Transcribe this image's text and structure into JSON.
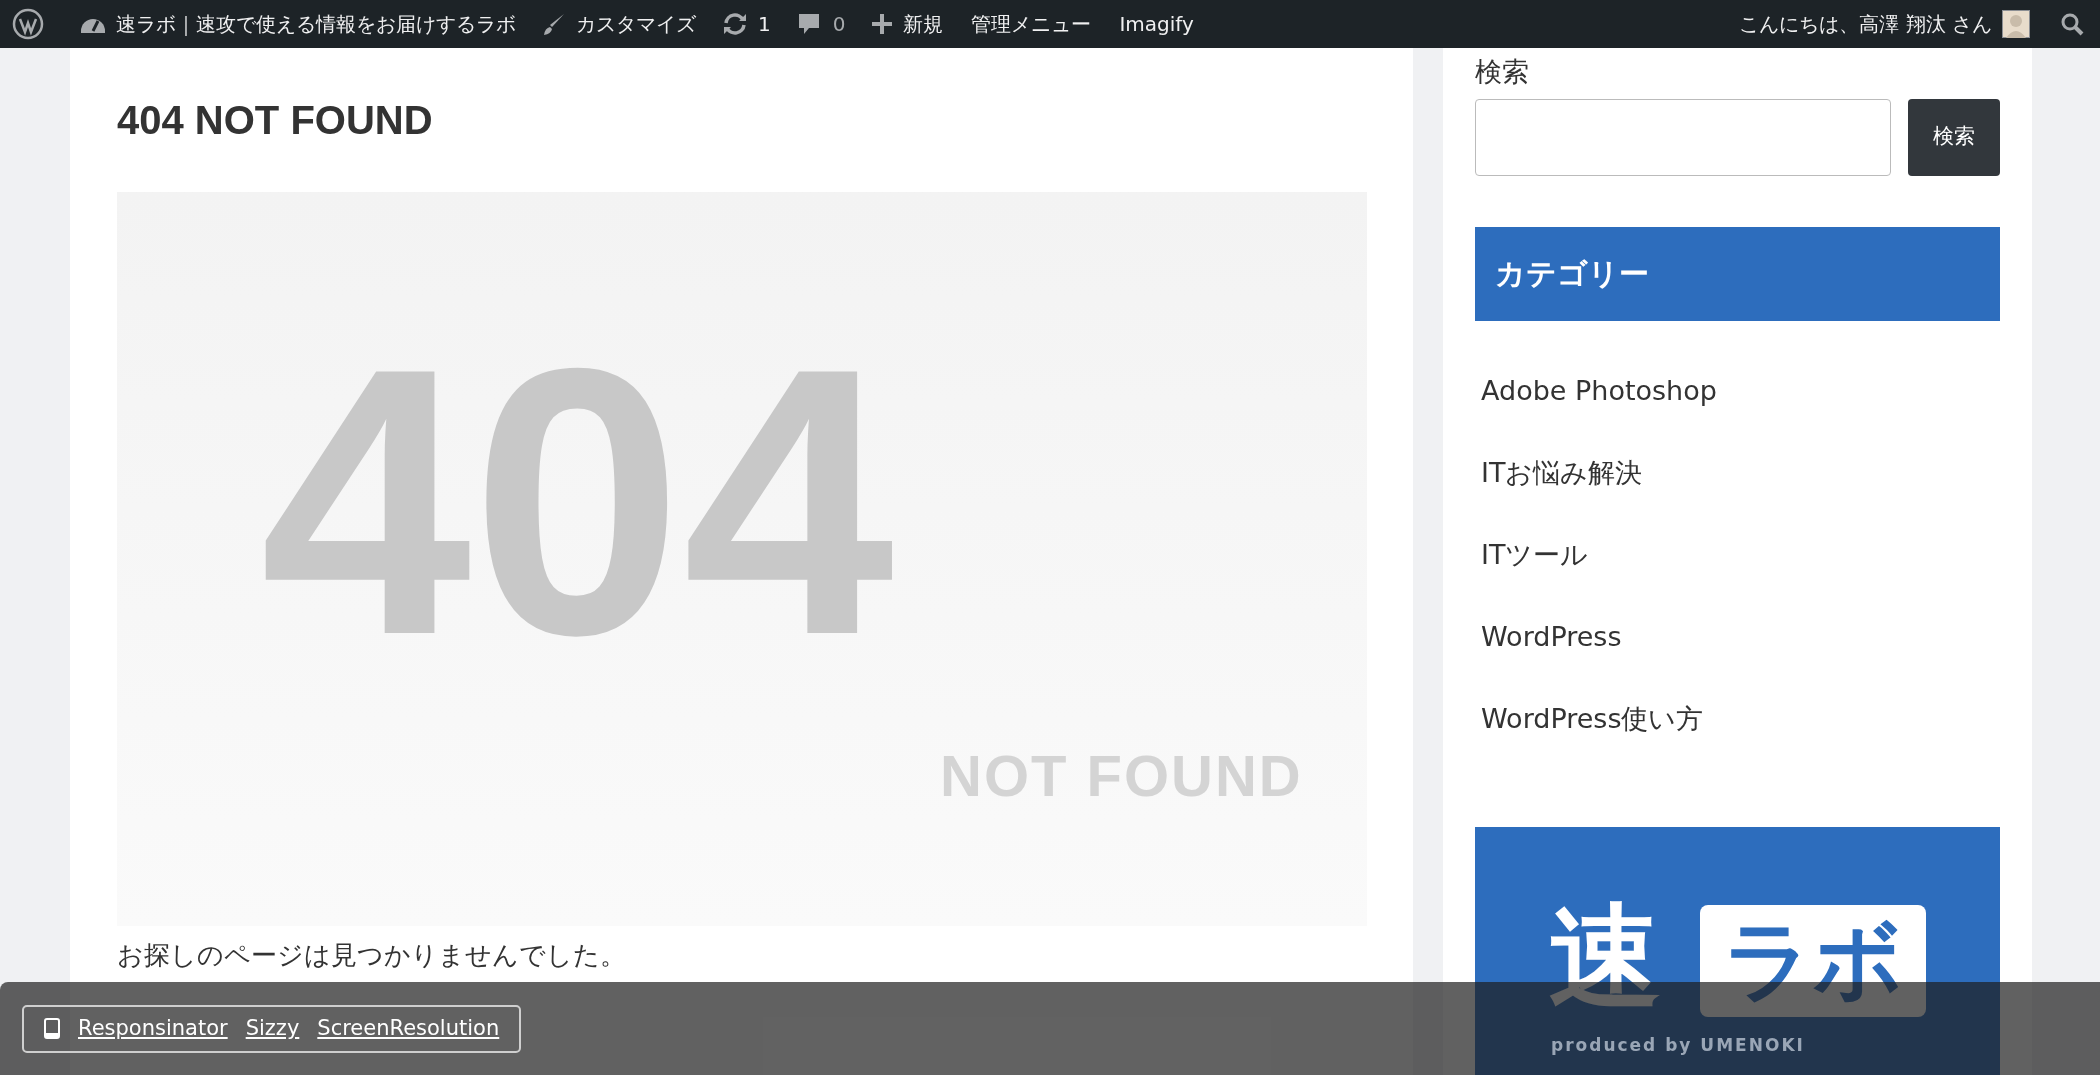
{
  "admin_bar": {
    "site_name": "速ラボ｜速攻で使える情報をお届けするラボ",
    "customize": "カスタマイズ",
    "updates": "1",
    "comments": "0",
    "new": "新規",
    "admin_menu": "管理メニュー",
    "imagify": "Imagify",
    "greeting": "こんにちは、高澤 翔汰 さん"
  },
  "main": {
    "title": "404 NOT FOUND",
    "hero": {
      "number": "404",
      "caption": "NOT FOUND"
    },
    "message": "お探しのページは見つかりませんでした。"
  },
  "sidebar": {
    "search": {
      "label": "検索",
      "button": "検索"
    },
    "category_heading": "カテゴリー",
    "categories": [
      "Adobe Photoshop",
      "ITお悩み解決",
      "ITツール",
      "WordPress",
      "WordPress使い方"
    ],
    "banner": {
      "mark": "速",
      "name": "ラボ",
      "tagline": "produced by UMENOKI"
    }
  },
  "bottom_bar": {
    "links": [
      "Responsinator",
      "Sizzy",
      "ScreenResolution"
    ]
  }
}
